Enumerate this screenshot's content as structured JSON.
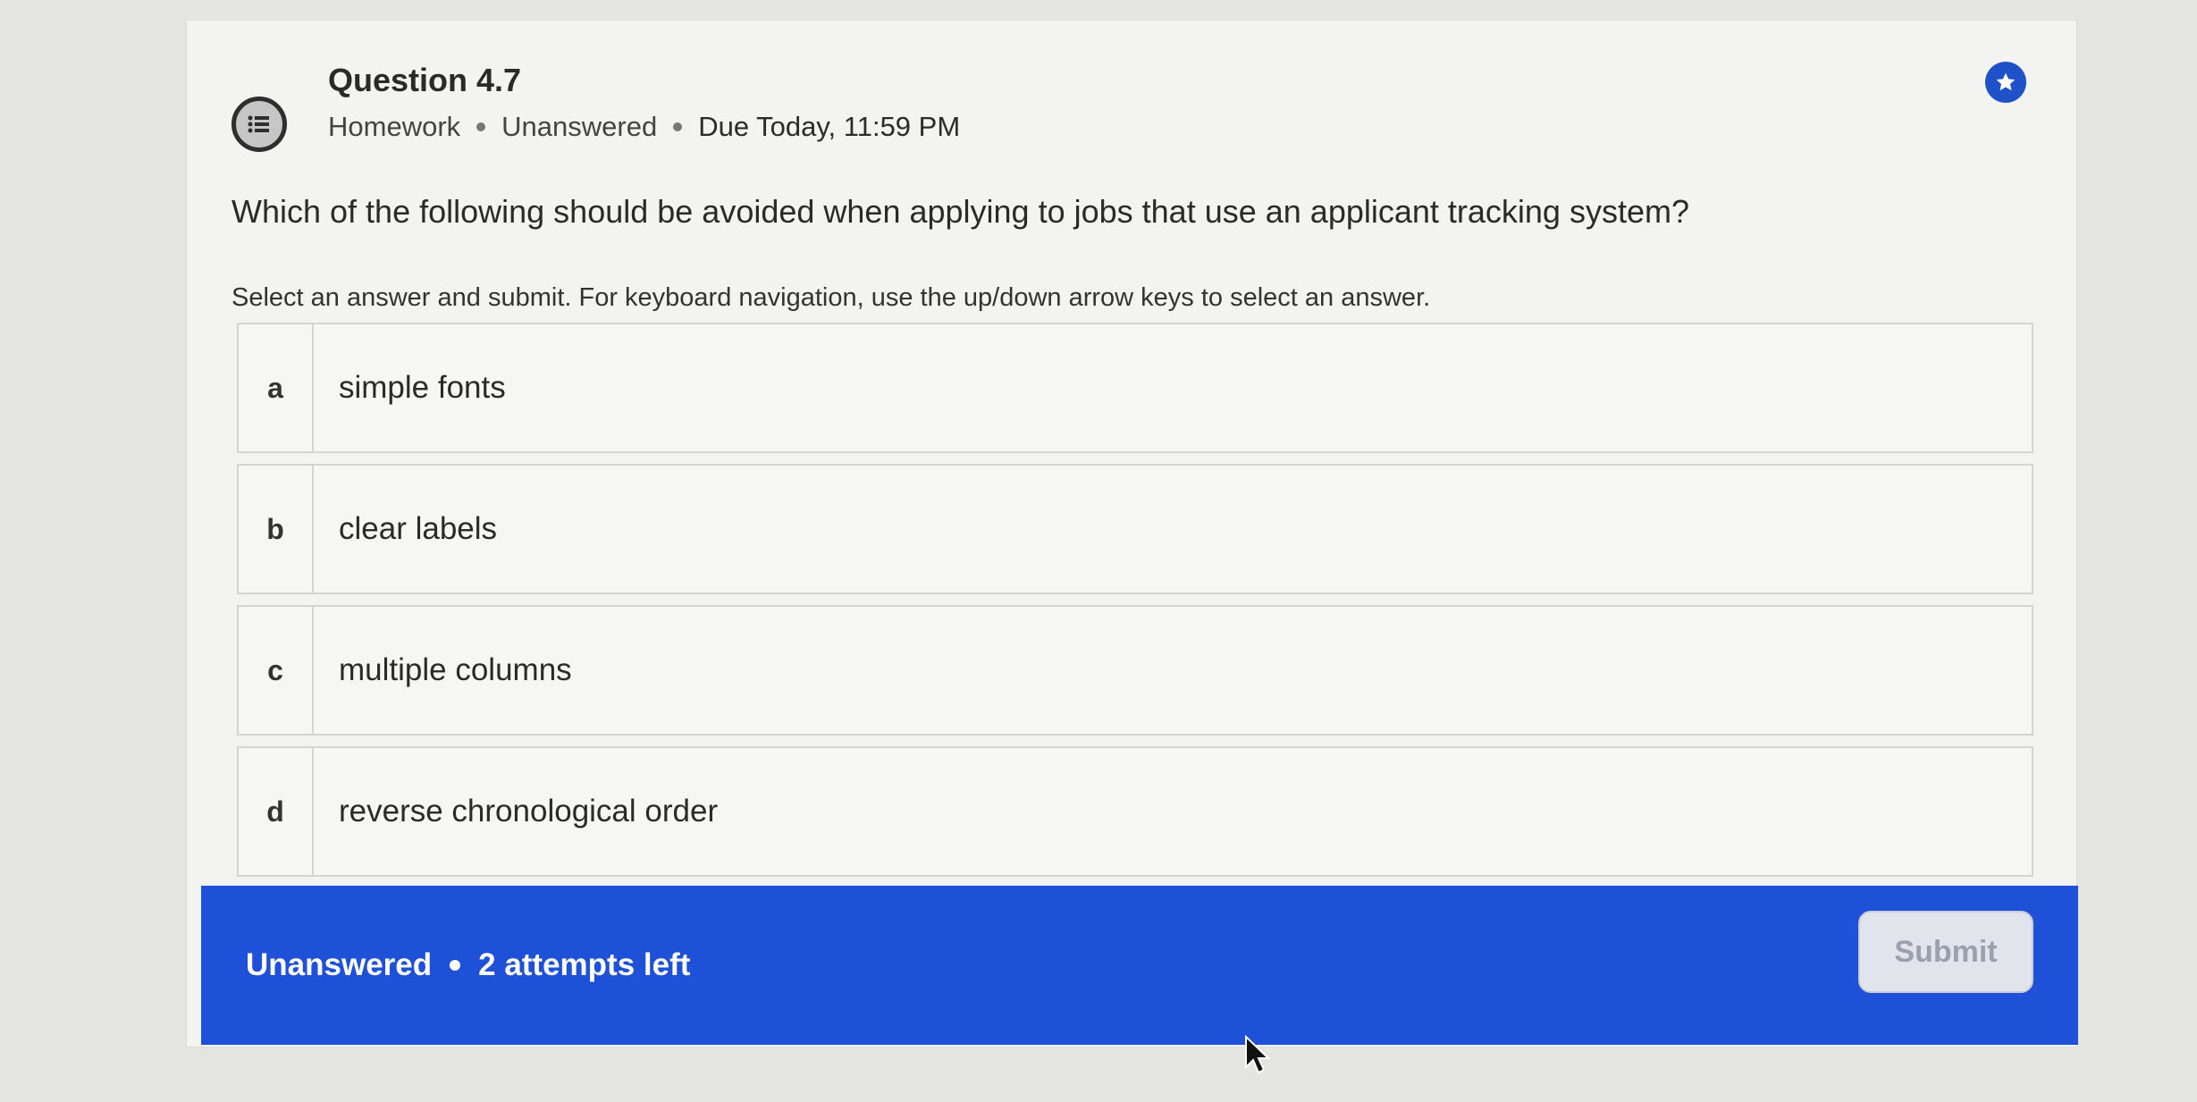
{
  "question": {
    "title": "Question 4.7",
    "meta": {
      "type": "Homework",
      "status": "Unanswered",
      "due": "Due Today, 11:59 PM"
    },
    "prompt": "Which of the following should be avoided when applying to jobs that use an applicant tracking system?",
    "instructions": "Select an answer and submit. For keyboard navigation, use the up/down arrow keys to select an answer."
  },
  "options": [
    {
      "letter": "a",
      "text": "simple fonts"
    },
    {
      "letter": "b",
      "text": "clear labels"
    },
    {
      "letter": "c",
      "text": "multiple columns"
    },
    {
      "letter": "d",
      "text": "reverse chronological order"
    }
  ],
  "footer": {
    "status": "Unanswered",
    "attempts": "2 attempts left",
    "submit_label": "Submit"
  },
  "icons": {
    "question_type": "list-bubble-icon",
    "favorite": "star-icon",
    "pointer": "mouse-cursor-icon"
  },
  "colors": {
    "accent": "#1f51d8",
    "submit_disabled_bg": "#e2e4ec",
    "submit_disabled_text": "#9aa0ae"
  }
}
